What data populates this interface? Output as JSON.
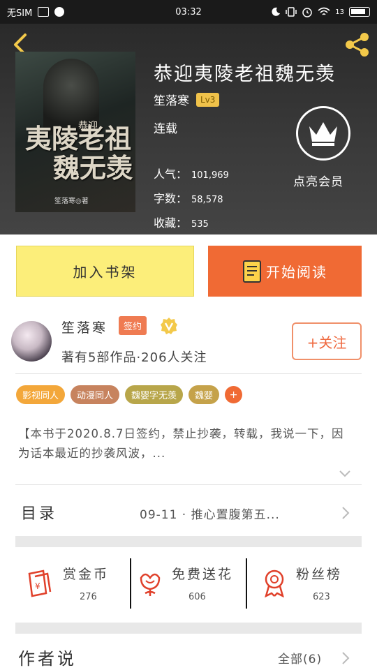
{
  "status_bar": {
    "carrier": "无SIM",
    "time": "03:32",
    "signal": "13",
    "icons": [
      "sim-card-icon",
      "circle-app-icon",
      "moon-icon",
      "vibrate-icon",
      "alarm-icon",
      "wifi-icon",
      "battery-icon"
    ]
  },
  "header": {
    "book_title": "恭迎夷陵老祖魏无羡",
    "author": "笙落寒",
    "level": "Lv3",
    "status": "连载",
    "stats": [
      {
        "label": "人气：",
        "value": "101,969"
      },
      {
        "label": "字数：",
        "value": "58,578"
      },
      {
        "label": "收藏：",
        "value": "535"
      }
    ],
    "vip_label": "点亮会员",
    "cover": {
      "title_line1": "夷陵老祖",
      "title_line2": "魏无羡",
      "title_prefix": "恭迎",
      "author_credit": "笙落寒◎著"
    }
  },
  "actions": {
    "add_shelf": "加入书架",
    "start_read": "开始阅读"
  },
  "author_block": {
    "name": "笙落寒",
    "badge": "签约",
    "meta": "著有5部作品·206人关注",
    "follow": "+关注"
  },
  "tags": [
    {
      "label": "影视同人",
      "color": "#f3a73a"
    },
    {
      "label": "动漫同人",
      "color": "#c7835e"
    },
    {
      "label": "魏婴字无羡",
      "color": "#b8a64a"
    },
    {
      "label": "魏婴",
      "color": "#c5a24a"
    }
  ],
  "tag_more": "+",
  "description": "【本书于2020.8.7日签约，禁止抄袭，转载，我说一下，因为话本最近的抄袭风波，...",
  "toc": {
    "label": "目录",
    "latest": "09-11 · 推心置腹第五..."
  },
  "stats_bar": [
    {
      "label": "赏金币",
      "value": "276",
      "icon": "red-envelope-icon"
    },
    {
      "label": "免费送花",
      "value": "606",
      "icon": "flower-icon"
    },
    {
      "label": "粉丝榜",
      "value": "623",
      "icon": "medal-icon"
    }
  ],
  "author_says": {
    "title": "作者说",
    "all_link": "全部(6)"
  },
  "colors": {
    "accent": "#f06a34",
    "shelf_button": "#fcee7a",
    "icon_red": "#e0402a",
    "share_yellow": "#f3c94a"
  }
}
